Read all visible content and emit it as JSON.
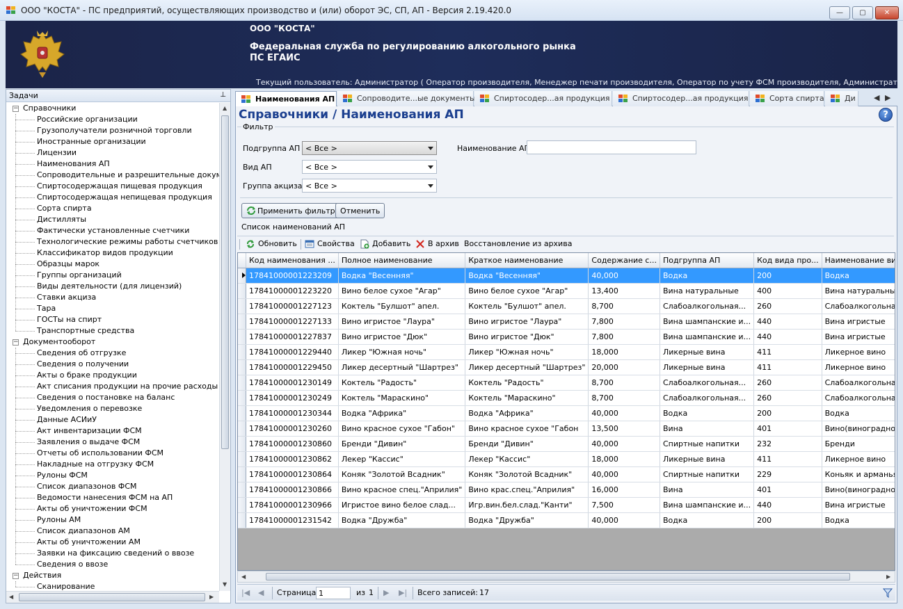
{
  "window": {
    "title": "ООО \"КОСТА\" - ПС предприятий, осуществляющих производство и (или) оборот ЭС, СП, АП - Версия 2.19.420.0",
    "minimize": "—",
    "maximize": "▢",
    "close": "✕"
  },
  "banner": {
    "org": "ООО \"КОСТА\"",
    "agency_line1": "Федеральная служба по регулированию алкогольного рынка",
    "agency_line2": "ПС ЕГАИС",
    "user": "Текущий пользователь: Администратор ( Оператор производителя, Менеджер печати производителя, Оператор по учету ФСМ производителя, Администратор производителя, О..."
  },
  "tasks": {
    "title": "Задачи",
    "pin": "⊥",
    "groups": [
      {
        "label": "Справочники",
        "items": [
          "Российские организации",
          "Грузополучатели розничной торговли",
          "Иностранные организации",
          "Лицензии",
          "Наименования АП",
          "Сопроводительные и разрешительные документы",
          "Спиртосодержащая пищевая продукция",
          "Спиртосодержащая непищевая продукция",
          "Сорта спирта",
          "Дистилляты",
          "Фактически установленные счетчики",
          "Технологические режимы работы счетчиков",
          "Классификатор видов продукции",
          "Образцы марок",
          "Группы организаций",
          "Виды деятельности (для лицензий)",
          "Ставки акциза",
          "Тара",
          "ГОСТы на спирт",
          "Транспортные средства"
        ]
      },
      {
        "label": "Документооборот",
        "items": [
          "Сведения об отгрузке",
          "Сведения о получении",
          "Акты о браке продукции",
          "Акт списания продукции на прочие расходы",
          "Сведения о постановке на баланс",
          "Уведомления о перевозке",
          "Данные АСИиУ",
          "Акт инвентаризации ФСМ",
          "Заявления о выдаче ФСМ",
          "Отчеты об использовании ФСМ",
          "Накладные на отгрузку ФСМ",
          "Рулоны ФСМ",
          "Список диапазонов ФСМ",
          "Ведомости нанесения ФСМ на АП",
          "Акты об уничтожении ФСМ",
          "Рулоны АМ",
          "Список диапазонов АМ",
          "Акты об уничтожении АМ",
          "Заявки на фиксацию сведений о ввозе",
          "Сведения о ввозе"
        ]
      },
      {
        "label": "Действия",
        "items": [
          "Сканирование"
        ]
      }
    ]
  },
  "tabs": [
    "Наименования АП",
    "Сопроводите...ые документы",
    "Спиртосодер...ая продукция",
    "Спиртосодер...ая продукция",
    "Сорта спирта",
    "Ди"
  ],
  "tab_nav": {
    "prev": "◀",
    "next": "▶"
  },
  "page": {
    "title": "Справочники /  Наименования АП",
    "help": "?"
  },
  "filter": {
    "legend": "Фильтр",
    "group_label": "Подгруппа АП",
    "group_value": "< Все >",
    "kind_label": "Вид АП",
    "kind_value": "< Все >",
    "excise_label": "Группа акциза",
    "excise_value": "< Все >",
    "name_label": "Наименование АП",
    "name_value": "",
    "apply": "Применить фильтр",
    "cancel": "Отменить"
  },
  "list": {
    "legend": "Список наименований АП",
    "toolbar": {
      "refresh": "Обновить",
      "props": "Свойства",
      "add": "Добавить",
      "archive": "В архив",
      "restore": "Восстановление из архива"
    },
    "columns": [
      "Код наименования ...",
      "Полное наименование",
      "Краткое наименование",
      "Содержание с...",
      "Подгруппа АП",
      "Код вида про...",
      "Наименование ви..."
    ],
    "rows": [
      [
        "17841000001223209",
        "Водка \"Весенняя\"",
        "Водка \"Весенняя\"",
        "40,000",
        "Водка",
        "200",
        "Водка"
      ],
      [
        "17841000001223220",
        "Вино белое сухое \"Агар\"",
        "Вино белое сухое \"Агар\"",
        "13,400",
        "Вина натуральные",
        "400",
        "Вина натуральные"
      ],
      [
        "17841000001227123",
        "Коктель \"Булшот\" апел.",
        "Коктель \"Булшот\" апел.",
        "8,700",
        "Слабоалкогольная...",
        "260",
        "Слабоалкогольная ..."
      ],
      [
        "17841000001227133",
        "Вино игристое \"Лаура\"",
        "Вино игристое \"Лаура\"",
        "7,800",
        "Вина шампанские и...",
        "440",
        "Вина игристые"
      ],
      [
        "17841000001227837",
        "Вино игристое \"Дюк\"",
        "Вино игристое \"Дюк\"",
        "7,800",
        "Вина шампанские и...",
        "440",
        "Вина игристые"
      ],
      [
        "17841000001229440",
        "Ликер \"Южная ночь\"",
        "Ликер \"Южная ночь\"",
        "18,000",
        "Ликерные вина",
        "411",
        "Ликерное вино"
      ],
      [
        "17841000001229450",
        "Ликер десертный \"Шартрез\"",
        "Ликер десертный \"Шартрез\"",
        "20,000",
        "Ликерные вина",
        "411",
        "Ликерное вино"
      ],
      [
        "17841000001230149",
        "Коктель \"Радость\"",
        "Коктель \"Радость\"",
        "8,700",
        "Слабоалкогольная...",
        "260",
        "Слабоалкогольная ..."
      ],
      [
        "17841000001230249",
        "Коктель \"Мараскино\"",
        "Коктель \"Мараскино\"",
        "8,700",
        "Слабоалкогольная...",
        "260",
        "Слабоалкогольная ..."
      ],
      [
        "17841000001230344",
        "Водка \"Африка\"",
        "Водка \"Африка\"",
        "40,000",
        "Водка",
        "200",
        "Водка"
      ],
      [
        "17841000001230260",
        "Вино красное сухое \"Габон\"",
        "Вино красное сухое \"Габон",
        "13,500",
        "Вина",
        "401",
        "Вино(виноградное)"
      ],
      [
        "17841000001230860",
        "Бренди \"Дивин\"",
        "Бренди \"Дивин\"",
        "40,000",
        "Спиртные напитки",
        "232",
        "Бренди"
      ],
      [
        "17841000001230862",
        "Лекер \"Кассис\"",
        "Лекер \"Кассис\"",
        "18,000",
        "Ликерные вина",
        "411",
        "Ликерное вино"
      ],
      [
        "17841000001230864",
        "Коняк \"Золотой Всадник\"",
        "Коняк \"Золотой Всадник\"",
        "40,000",
        "Спиртные напитки",
        "229",
        "Коньяк и арманьяк..."
      ],
      [
        "17841000001230866",
        "Вино красное спец.\"Априлия\"",
        "Вино крас.спец.\"Априлия\"",
        "16,000",
        "Вина",
        "401",
        "Вино(виноградное)"
      ],
      [
        "17841000001230966",
        "Игристое вино белое слад...",
        "Игр.вин.бел.слад.\"Канти\"",
        "7,500",
        "Вина шампанские и...",
        "440",
        "Вина игристые"
      ],
      [
        "17841000001231542",
        "Водка \"Дружба\"",
        "Водка \"Дружба\"",
        "40,000",
        "Водка",
        "200",
        "Водка"
      ]
    ]
  },
  "pager": {
    "page_label": "Страница",
    "page_value": "1",
    "of_label": "из",
    "of_value": "1",
    "total_label": "Всего записей:",
    "total_value": "17",
    "first": "|◀",
    "prev": "◀",
    "next": "▶",
    "last": "▶|"
  },
  "colors": {
    "accent": "#1b3f8f",
    "selection": "#3399ff",
    "banner": "#1e2d5a"
  }
}
